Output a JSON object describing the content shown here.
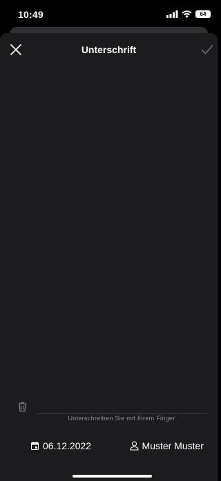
{
  "status_bar": {
    "time": "10:49",
    "battery": "64"
  },
  "header": {
    "title": "Unterschrift"
  },
  "signature": {
    "hint": "Unterschreiben Sie mit Ihrem Finger"
  },
  "footer": {
    "date": "06.12.2022",
    "name": "Muster Muster"
  },
  "colors": {
    "background": "#1c1c1e",
    "text": "#ffffff",
    "muted": "#8e8e93"
  }
}
